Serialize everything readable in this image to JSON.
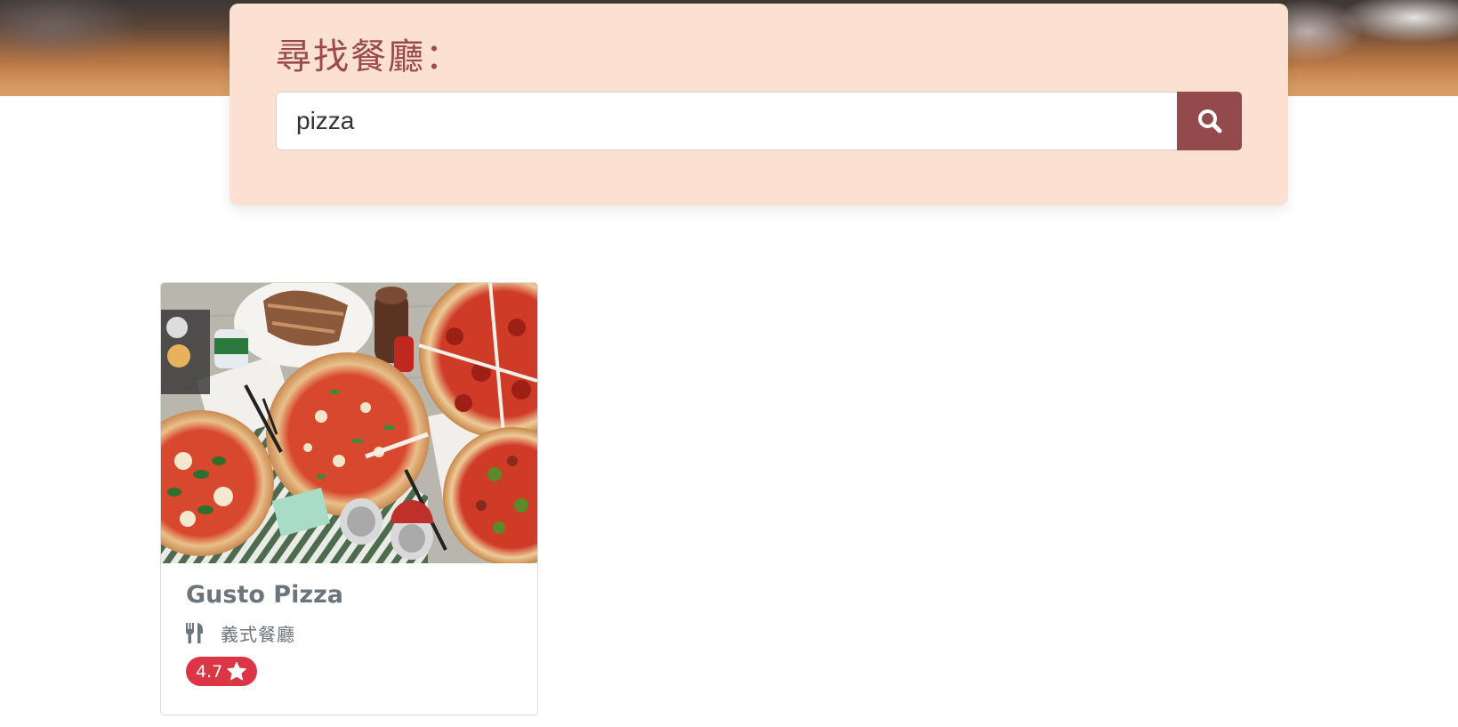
{
  "search": {
    "title": "尋找餐廳：",
    "value": "pizza",
    "button_icon": "search-icon"
  },
  "results": [
    {
      "name": "Gusto Pizza",
      "category": "義式餐廳",
      "category_icon": "utensils-icon",
      "rating": "4.7",
      "rating_icon": "star-icon",
      "image": "pizza-photo"
    }
  ],
  "colors": {
    "panel_bg": "#fce1d2",
    "accent": "#944a4c",
    "title_text": "#9a4a4a",
    "badge": "#dc3545",
    "muted_text": "#6c757d"
  }
}
